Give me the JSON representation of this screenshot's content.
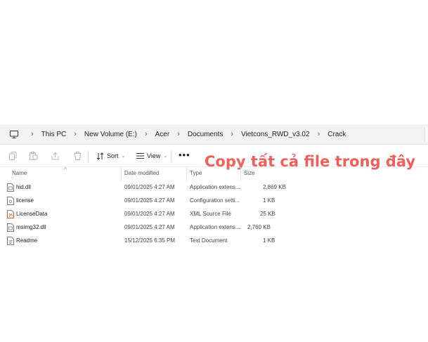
{
  "breadcrumb": {
    "items": [
      "This PC",
      "New Volume (E:)",
      "Acer",
      "Documents",
      "Vietcons_RWD_v3.02",
      "Crack"
    ]
  },
  "toolbar": {
    "sort_label": "Sort",
    "view_label": "View",
    "more_label": "•••",
    "icons": [
      "copy-icon",
      "paste-icon",
      "share-icon",
      "delete-icon"
    ]
  },
  "overlay": {
    "text": "Copy tất cả file trong đây",
    "color": "#f0605a"
  },
  "columns": {
    "name": "Name",
    "date": "Date modified",
    "type": "Type",
    "size": "Size"
  },
  "files": [
    {
      "name": "hid.dll",
      "date": "09/01/2025 4:27 AM",
      "type": "Application extens...",
      "size": "2,869 KB",
      "icon": "dll"
    },
    {
      "name": "license",
      "date": "09/01/2025 4:27 AM",
      "type": "Configuration setti...",
      "size": "1 KB",
      "icon": "config"
    },
    {
      "name": "LicenseData",
      "date": "09/01/2025 4:27 AM",
      "type": "XML Source File",
      "size": "25 KB",
      "icon": "xml"
    },
    {
      "name": "msimg32.dll",
      "date": "09/01/2025 4:27 AM",
      "type": "Application extens...",
      "size": "2,760 KB",
      "icon": "dll"
    },
    {
      "name": "Readme",
      "date": "15/12/2025 6:35 PM",
      "type": "Text Document",
      "size": "1 KB",
      "icon": "text"
    }
  ]
}
